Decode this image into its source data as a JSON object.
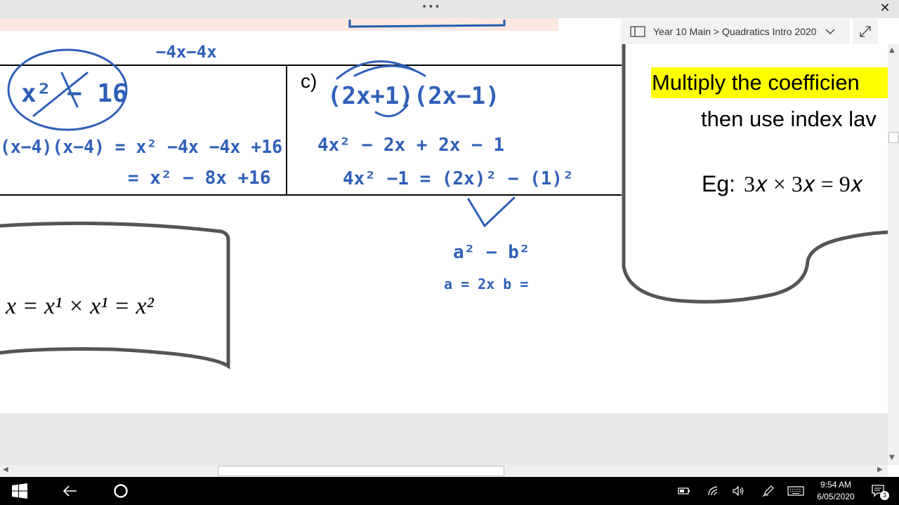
{
  "window": {
    "grip_label": "•••",
    "close_icon": "close-icon"
  },
  "breadcrumb": {
    "label": "Year 10 Main > Quadratics Intro 2020",
    "notebook_icon": "notebook-icon",
    "chevron_icon": "chevron-down-icon",
    "expand_icon": "expand-icon"
  },
  "slide": {
    "highlight_text": "Multiply the coefficien",
    "then_text": "then use index lav",
    "example_label": "Eg:",
    "example_expr": "3𝑥 × 3𝑥 = 9𝑥",
    "left_equation": "x = x¹ × x¹ = x²",
    "part_label": "c)"
  },
  "ink": {
    "color": "#2f5fb8",
    "top_note": "−4x−4x",
    "box_expr": "x² − 16",
    "left_working_1": "(x−4)(x−4) = x² −4x −4x +16",
    "left_working_2": "= x² − 8x +16",
    "c_expr": "(2x+1)(2x−1)",
    "c_working_1": "4x² − 2x + 2x − 1",
    "c_working_2": "4x² −1 = (2x)² − (1)²",
    "c_working_3": "a² − b²",
    "c_working_4": "a = 2x    b ="
  },
  "taskbar": {
    "time": "9:54 AM",
    "date": "6/05/2020",
    "notification_count": "3"
  }
}
